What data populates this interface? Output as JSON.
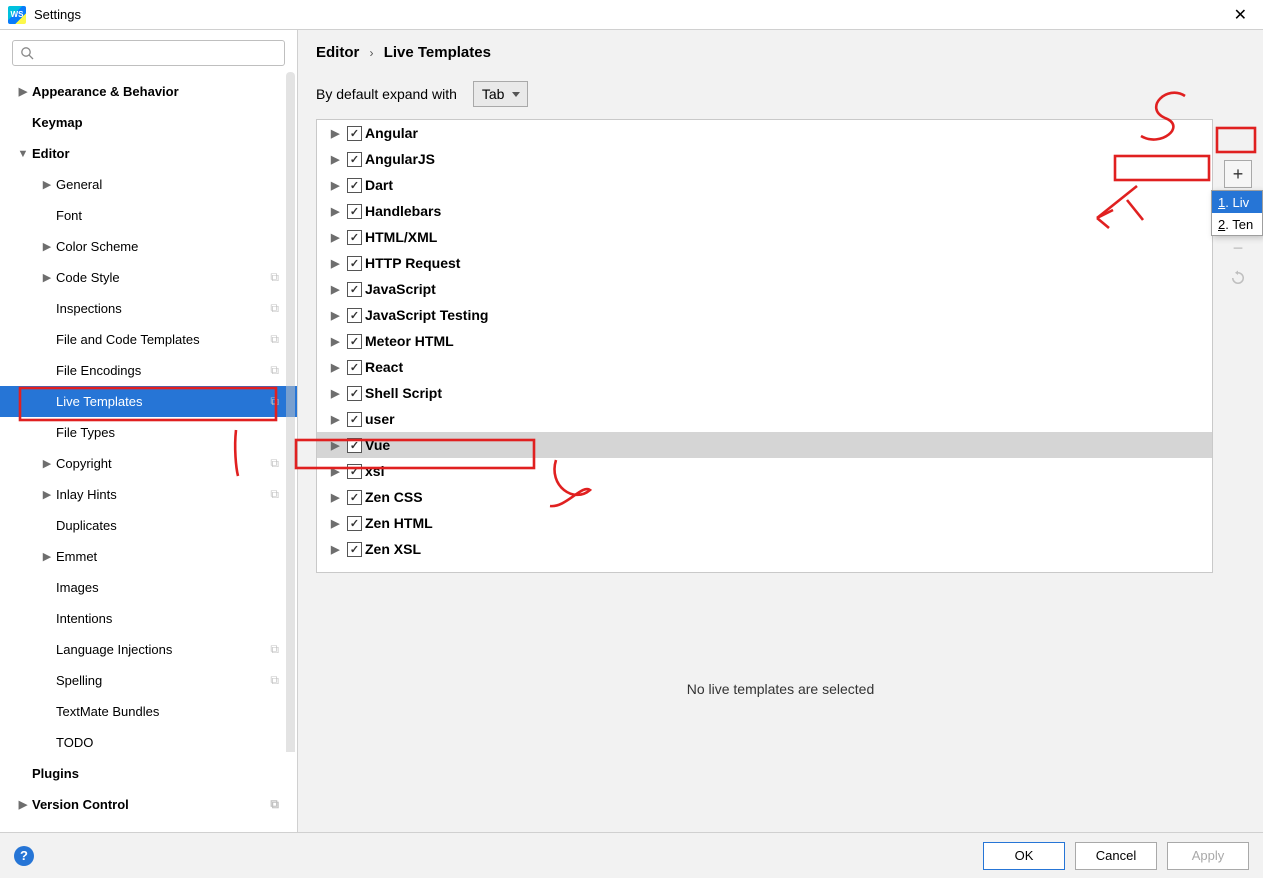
{
  "window": {
    "title": "Settings"
  },
  "search": {
    "placeholder": ""
  },
  "sidebar": {
    "items": [
      {
        "label": "Appearance & Behavior",
        "level": 1,
        "arrow": "right",
        "cfg": false
      },
      {
        "label": "Keymap",
        "level": 1,
        "arrow": "",
        "cfg": false
      },
      {
        "label": "Editor",
        "level": 1,
        "arrow": "down",
        "cfg": false
      },
      {
        "label": "General",
        "level": 2,
        "arrow": "right",
        "cfg": false
      },
      {
        "label": "Font",
        "level": 2,
        "arrow": "",
        "cfg": false
      },
      {
        "label": "Color Scheme",
        "level": 2,
        "arrow": "right",
        "cfg": false
      },
      {
        "label": "Code Style",
        "level": 2,
        "arrow": "right",
        "cfg": true
      },
      {
        "label": "Inspections",
        "level": 2,
        "arrow": "",
        "cfg": true
      },
      {
        "label": "File and Code Templates",
        "level": 2,
        "arrow": "",
        "cfg": true
      },
      {
        "label": "File Encodings",
        "level": 2,
        "arrow": "",
        "cfg": true
      },
      {
        "label": "Live Templates",
        "level": 2,
        "arrow": "",
        "cfg": true,
        "selected": true
      },
      {
        "label": "File Types",
        "level": 2,
        "arrow": "",
        "cfg": false
      },
      {
        "label": "Copyright",
        "level": 2,
        "arrow": "right",
        "cfg": true
      },
      {
        "label": "Inlay Hints",
        "level": 2,
        "arrow": "right",
        "cfg": true
      },
      {
        "label": "Duplicates",
        "level": 2,
        "arrow": "",
        "cfg": false
      },
      {
        "label": "Emmet",
        "level": 2,
        "arrow": "right",
        "cfg": false
      },
      {
        "label": "Images",
        "level": 2,
        "arrow": "",
        "cfg": false
      },
      {
        "label": "Intentions",
        "level": 2,
        "arrow": "",
        "cfg": false
      },
      {
        "label": "Language Injections",
        "level": 2,
        "arrow": "",
        "cfg": true
      },
      {
        "label": "Spelling",
        "level": 2,
        "arrow": "",
        "cfg": true
      },
      {
        "label": "TextMate Bundles",
        "level": 2,
        "arrow": "",
        "cfg": false
      },
      {
        "label": "TODO",
        "level": 2,
        "arrow": "",
        "cfg": false
      },
      {
        "label": "Plugins",
        "level": 1,
        "arrow": "",
        "cfg": false
      },
      {
        "label": "Version Control",
        "level": 1,
        "arrow": "right",
        "cfg": true
      }
    ]
  },
  "breadcrumb": {
    "root": "Editor",
    "page": "Live Templates"
  },
  "expand": {
    "label": "By default expand with",
    "value": "Tab"
  },
  "templates": [
    {
      "label": "Angular",
      "selected": false
    },
    {
      "label": "AngularJS",
      "selected": false
    },
    {
      "label": "Dart",
      "selected": false
    },
    {
      "label": "Handlebars",
      "selected": false
    },
    {
      "label": "HTML/XML",
      "selected": false
    },
    {
      "label": "HTTP Request",
      "selected": false
    },
    {
      "label": "JavaScript",
      "selected": false
    },
    {
      "label": "JavaScript Testing",
      "selected": false
    },
    {
      "label": "Meteor HTML",
      "selected": false
    },
    {
      "label": "React",
      "selected": false
    },
    {
      "label": "Shell Script",
      "selected": false
    },
    {
      "label": "user",
      "selected": false
    },
    {
      "label": "Vue",
      "selected": true
    },
    {
      "label": "xsl",
      "selected": false
    },
    {
      "label": "Zen CSS",
      "selected": false
    },
    {
      "label": "Zen HTML",
      "selected": false
    },
    {
      "label": "Zen XSL",
      "selected": false
    }
  ],
  "popup": {
    "item1": "1. Liv",
    "item2": "2. Ten"
  },
  "detail": {
    "message": "No live templates are selected"
  },
  "footer": {
    "ok": "OK",
    "cancel": "Cancel",
    "apply": "Apply"
  },
  "annotations": {
    "n1": "1",
    "n2": "2",
    "n3": "3",
    "n4": "4"
  }
}
